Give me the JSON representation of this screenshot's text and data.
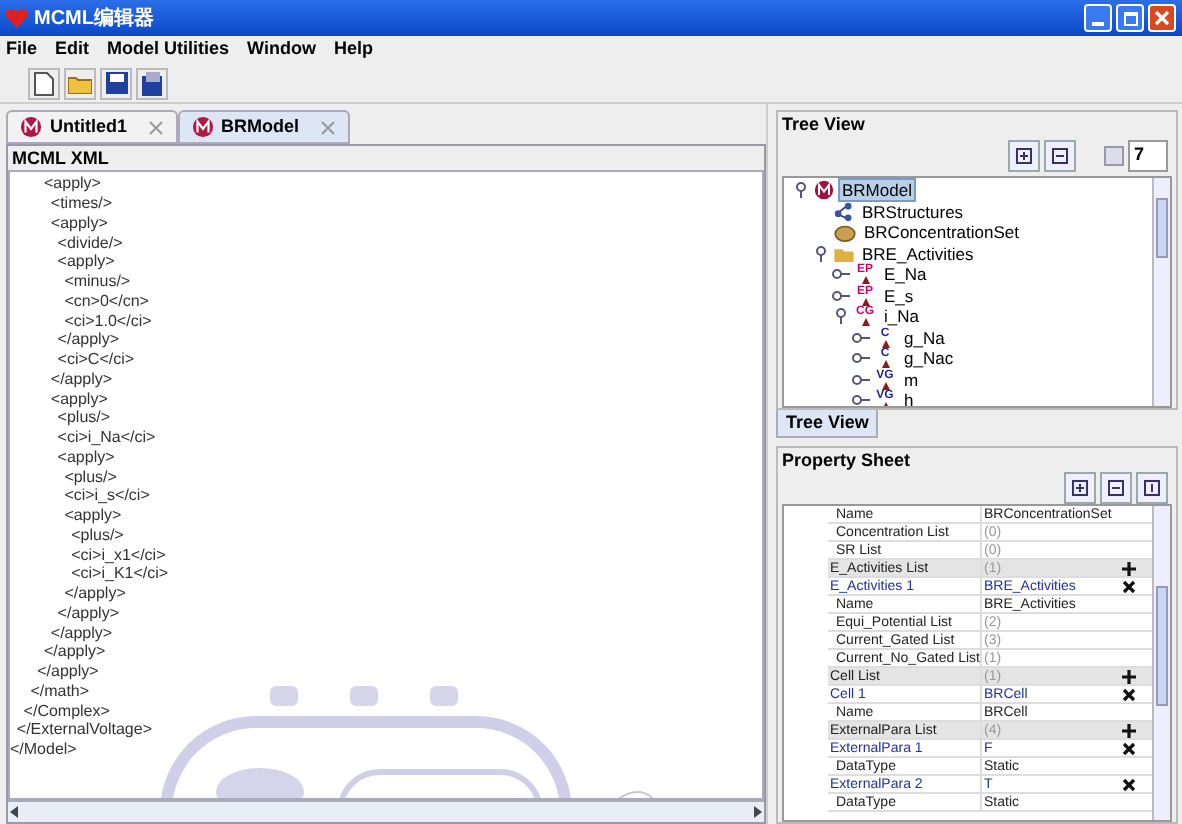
{
  "window": {
    "title": "MCML编辑器"
  },
  "menu": [
    "File",
    "Edit",
    "Model Utilities",
    "Window",
    "Help"
  ],
  "editor": {
    "tabs": [
      {
        "label": "Untitled1",
        "selected": false
      },
      {
        "label": "BRModel",
        "selected": true
      }
    ],
    "heading": "MCML XML",
    "xml": [
      {
        "close": "</Model>",
        "children": [
          {
            "close": "</ExternalVoltage>",
            "children": [
              {
                "close": "</Complex>",
                "children": [
                  {
                    "close": "</math>",
                    "children": [
                      {
                        "close": "</apply>",
                        "children": [
                          {
                            "open": "<apply>",
                            "close": "</apply>",
                            "children": [
                              {
                                "open": "<times/>"
                              },
                              {
                                "open": "<apply>",
                                "close": "</apply>",
                                "children": [
                                  {
                                    "open": "<divide/>"
                                  },
                                  {
                                    "open": "<apply>",
                                    "close": "</apply>",
                                    "children": [
                                      {
                                        "open": "<minus/>"
                                      },
                                      {
                                        "open": "<cn>0</cn>"
                                      },
                                      {
                                        "open": "<ci>1.0</ci>"
                                      }
                                    ]
                                  },
                                  {
                                    "open": "<ci>C</ci>"
                                  }
                                ]
                              },
                              {
                                "open": "<apply>",
                                "close": "</apply>",
                                "children": [
                                  {
                                    "open": "<plus/>"
                                  },
                                  {
                                    "open": "<ci>i_Na</ci>"
                                  },
                                  {
                                    "open": "<apply>",
                                    "close": "</apply>",
                                    "children": [
                                      {
                                        "open": "<plus/>"
                                      },
                                      {
                                        "open": "<ci>i_s</ci>"
                                      },
                                      {
                                        "open": "<apply>",
                                        "close": "</apply>",
                                        "children": [
                                          {
                                            "open": "<plus/>"
                                          },
                                          {
                                            "open": "<ci>i_x1</ci>"
                                          },
                                          {
                                            "open": "<ci>i_K1</ci>"
                                          }
                                        ]
                                      }
                                    ]
                                  }
                                ]
                              }
                            ]
                          }
                        ]
                      }
                    ]
                  }
                ]
              }
            ]
          }
        ]
      }
    ]
  },
  "tree_view": {
    "title": "Tree View",
    "spinner": "7",
    "tab": "Tree View",
    "nodes": [
      {
        "label": "BRModel",
        "kind": "model",
        "selected": true,
        "expanded": true,
        "children": [
          {
            "label": "BRStructures",
            "kind": "structures",
            "selected": false
          },
          {
            "label": "BRConcentrationSet",
            "kind": "concentration",
            "selected": false
          },
          {
            "label": "BRE_Activities",
            "kind": "activities",
            "selected": false,
            "expanded": true,
            "children": [
              {
                "label": "E_Na",
                "kind": "badge",
                "badge": "EP",
                "selected": false,
                "expanded": false
              },
              {
                "label": "E_s",
                "kind": "badge",
                "badge": "EP",
                "selected": false,
                "expanded": false
              },
              {
                "label": "i_Na",
                "kind": "badge",
                "badge": "CG",
                "selected": false,
                "expanded": true,
                "children": [
                  {
                    "label": "g_Na",
                    "kind": "badge",
                    "badge": "C",
                    "selected": false,
                    "expanded": false
                  },
                  {
                    "label": "g_Nac",
                    "kind": "badge",
                    "badge": "C",
                    "selected": false,
                    "expanded": false
                  },
                  {
                    "label": "m",
                    "kind": "badge",
                    "badge": "VG",
                    "selected": false,
                    "expanded": false
                  },
                  {
                    "label": "h",
                    "kind": "badge",
                    "badge": "VG",
                    "selected": false,
                    "expanded": false
                  }
                ]
              }
            ]
          }
        ]
      }
    ]
  },
  "property_sheet": {
    "title": "Property Sheet",
    "rows": [
      {
        "kind": "item",
        "name": "Name",
        "value": "BRConcentrationSet"
      },
      {
        "kind": "item",
        "name": "Concentration List",
        "value": "(0)"
      },
      {
        "kind": "item",
        "name": "SR List",
        "value": "(0)"
      },
      {
        "kind": "list",
        "name": "E_Activities List",
        "value": "(1)"
      },
      {
        "kind": "entry",
        "name": "E_Activities 1",
        "value": "BRE_Activities"
      },
      {
        "kind": "item",
        "name": "Name",
        "value": "BRE_Activities"
      },
      {
        "kind": "item",
        "name": "Equi_Potential List",
        "value": "(2)"
      },
      {
        "kind": "item",
        "name": "Current_Gated List",
        "value": "(3)"
      },
      {
        "kind": "item",
        "name": "Current_No_Gated List",
        "value": "(1)"
      },
      {
        "kind": "list",
        "name": "Cell List",
        "value": "(1)"
      },
      {
        "kind": "entry",
        "name": "Cell 1",
        "value": "BRCell"
      },
      {
        "kind": "item",
        "name": "Name",
        "value": "BRCell"
      },
      {
        "kind": "list",
        "name": "ExternalPara List",
        "value": "(4)"
      },
      {
        "kind": "entry",
        "name": "ExternalPara 1",
        "value": "F"
      },
      {
        "kind": "item",
        "name": "DataType",
        "value": "Static"
      },
      {
        "kind": "entry",
        "name": "ExternalPara 2",
        "value": "T"
      },
      {
        "kind": "item",
        "name": "DataType",
        "value": "Static"
      }
    ]
  }
}
